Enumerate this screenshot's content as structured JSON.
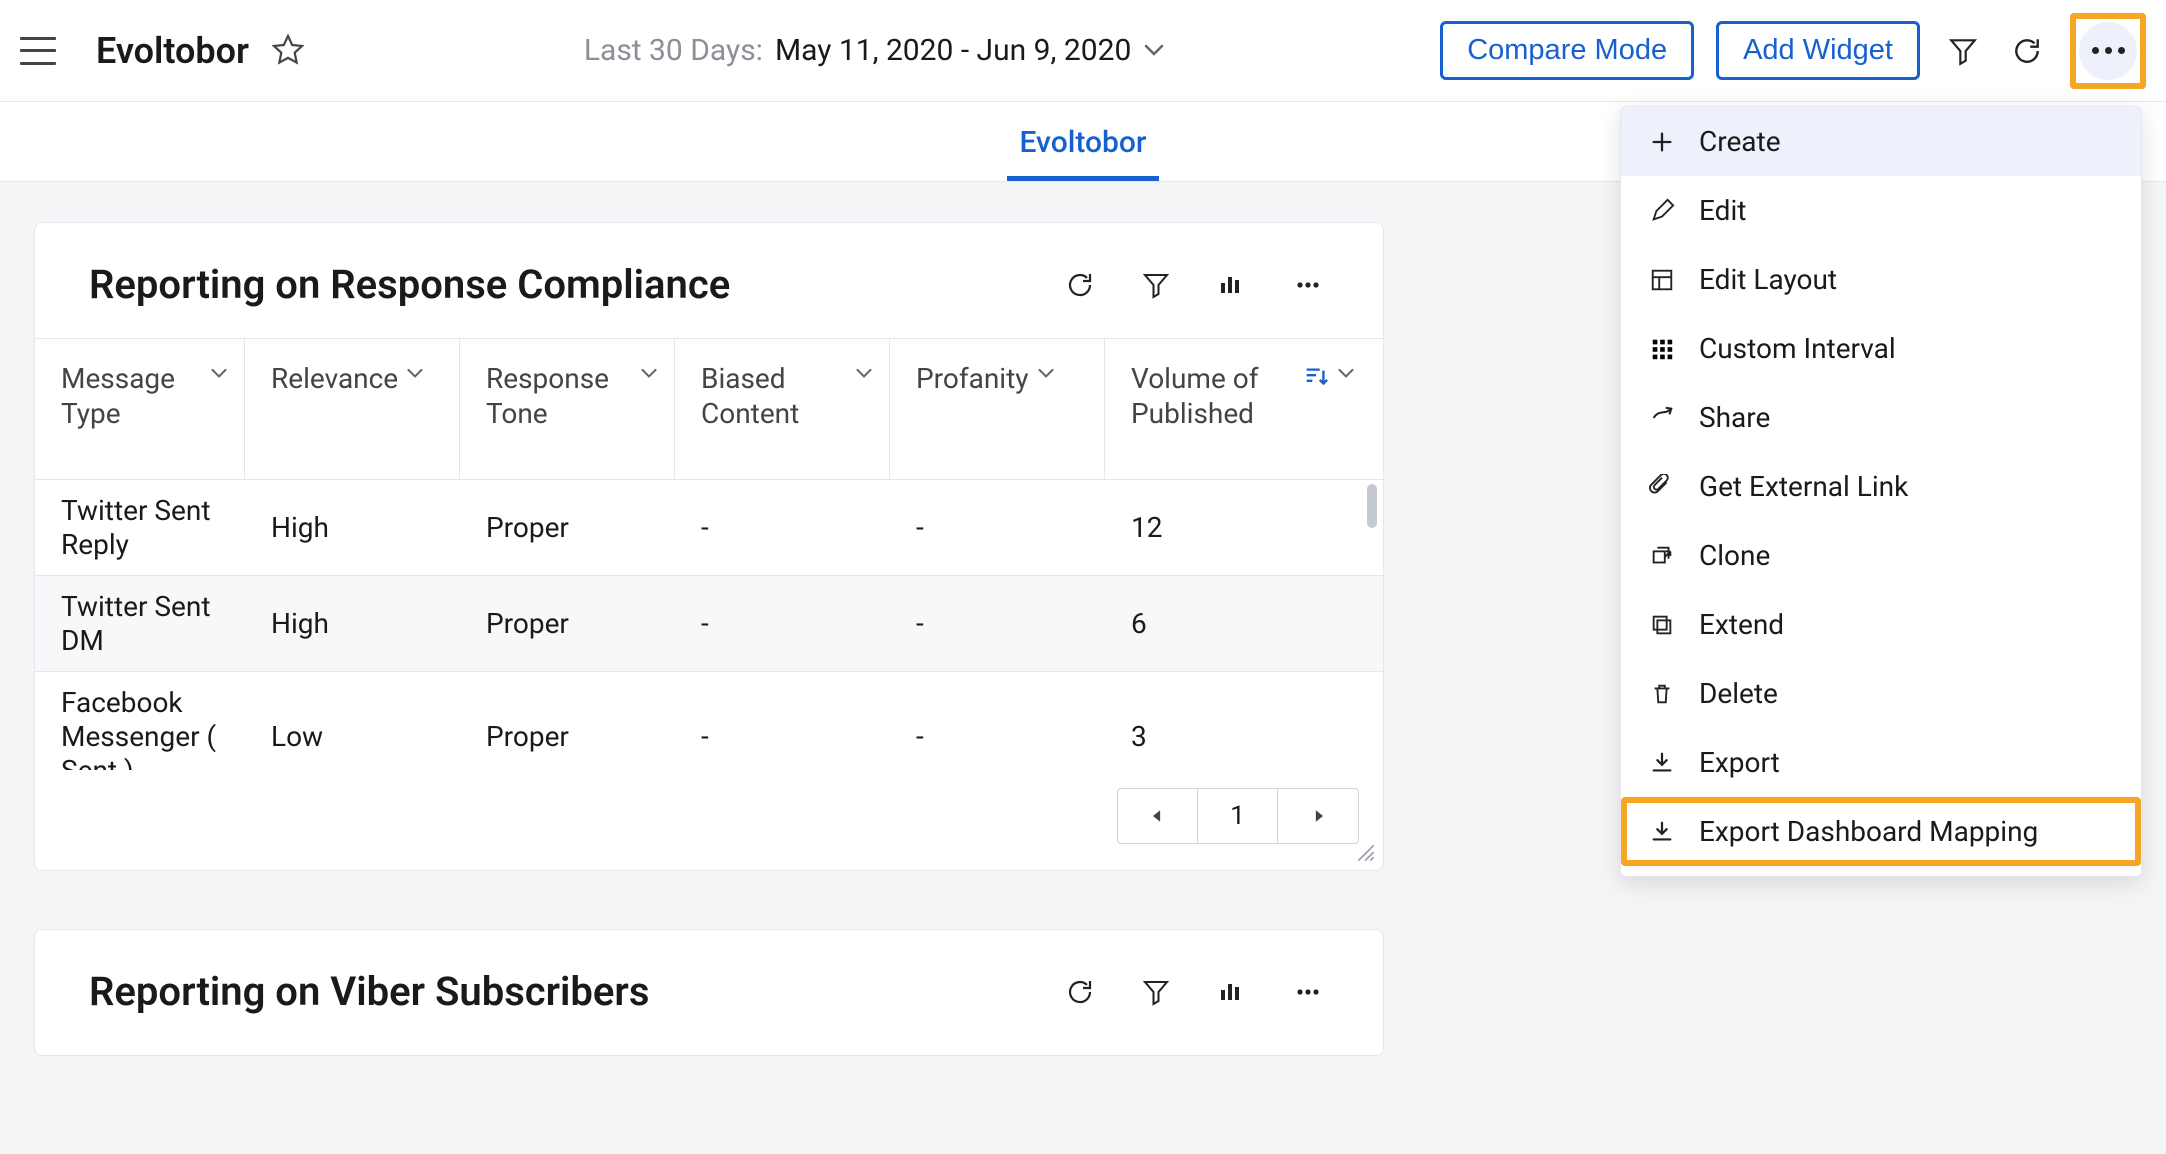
{
  "header": {
    "dashboard_title": "Evoltobor",
    "date_range_prefix": "Last 30 Days:",
    "date_range_value": "May 11, 2020 - Jun 9, 2020",
    "compare_label": "Compare Mode",
    "add_widget_label": "Add Widget"
  },
  "tabs": {
    "active": "Evoltobor"
  },
  "widget1": {
    "title": "Reporting on Response Compliance",
    "columns": [
      "Message Type",
      "Relevance",
      "Response Tone",
      "Biased Content",
      "Profanity",
      "Volume of Published"
    ],
    "rows": [
      {
        "c0": "Twitter Sent Reply",
        "c1": "High",
        "c2": "Proper",
        "c3": "-",
        "c4": "-",
        "c5": "12"
      },
      {
        "c0": "Twitter Sent DM",
        "c1": "High",
        "c2": "Proper",
        "c3": "-",
        "c4": "-",
        "c5": "6"
      },
      {
        "c0": "Facebook Messenger ( Sent )",
        "c1": "Low",
        "c2": "Proper",
        "c3": "-",
        "c4": "-",
        "c5": "3"
      }
    ],
    "page": "1"
  },
  "widget2": {
    "title": "Reporting on Viber Subscribers"
  },
  "menu": {
    "items": [
      {
        "label": "Create",
        "icon": "plus",
        "hover": true
      },
      {
        "label": "Edit",
        "icon": "pencil"
      },
      {
        "label": "Edit Layout",
        "icon": "layout"
      },
      {
        "label": "Custom Interval",
        "icon": "grid"
      },
      {
        "label": "Share",
        "icon": "share"
      },
      {
        "label": "Get External Link",
        "icon": "clip"
      },
      {
        "label": "Clone",
        "icon": "clone"
      },
      {
        "label": "Extend",
        "icon": "extend"
      },
      {
        "label": "Delete",
        "icon": "trash"
      },
      {
        "label": "Export",
        "icon": "download"
      },
      {
        "label": "Export Dashboard Mapping",
        "icon": "download",
        "highlight": true
      }
    ]
  }
}
